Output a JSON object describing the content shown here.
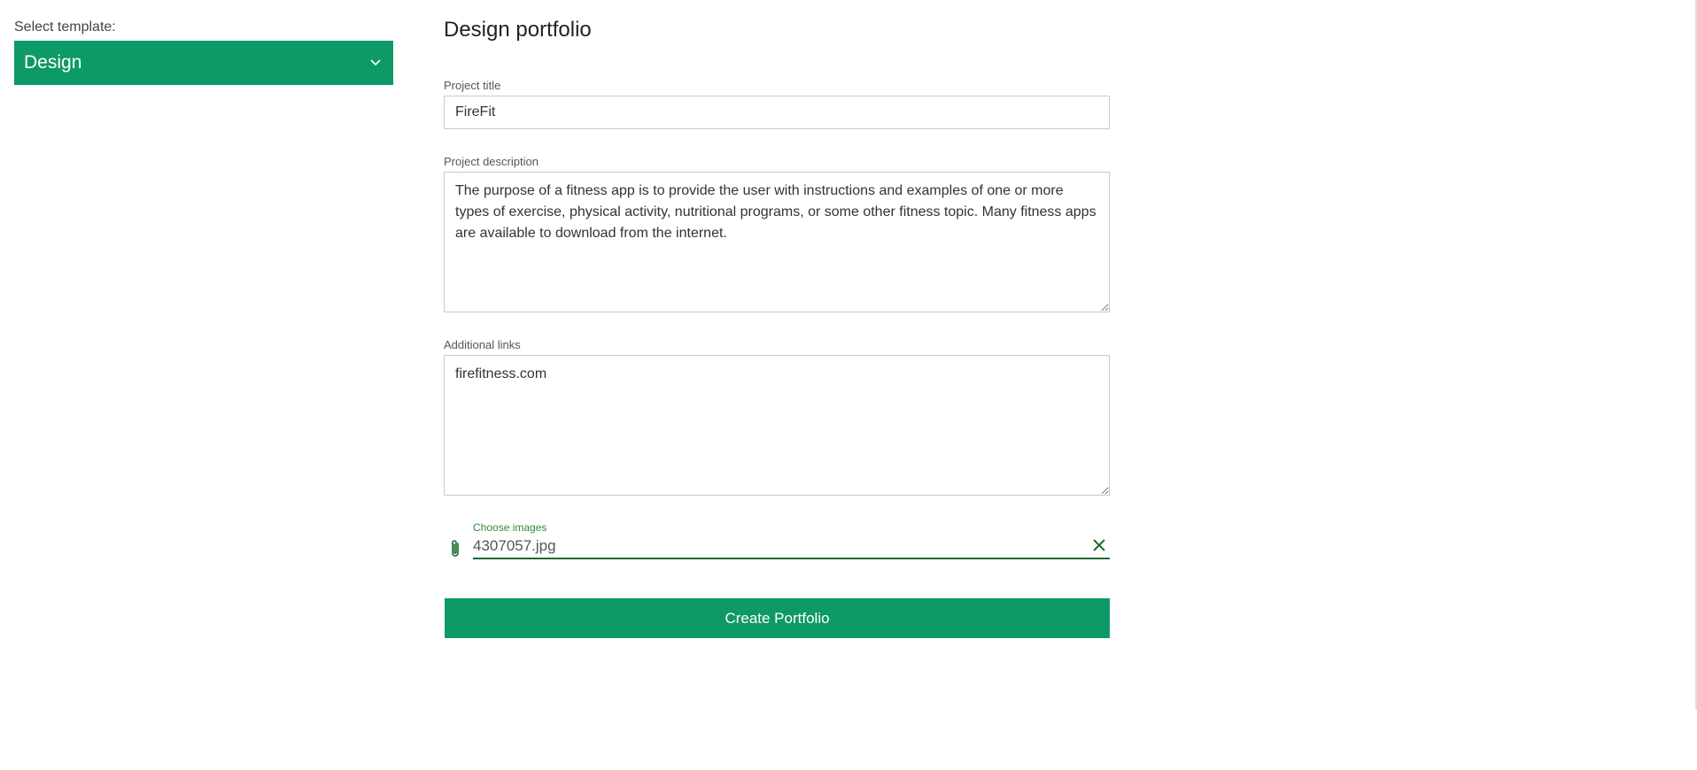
{
  "sidebar": {
    "select_label": "Select template:",
    "template_value": "Design",
    "chevron_icon": "chevron-down-icon"
  },
  "form": {
    "title": "Design portfolio",
    "project_title": {
      "label": "Project title",
      "value": "FireFit"
    },
    "project_description": {
      "label": "Project description",
      "value": "The purpose of a fitness app is to provide the user with instructions and examples of one or more types of exercise, physical activity, nutritional programs, or some other fitness topic. Many fitness apps are available to download from the internet."
    },
    "additional_links": {
      "label": "Additional links",
      "value": "firefitness.com"
    },
    "images": {
      "label": "Choose images",
      "value": "4307057.jpg",
      "attach_icon": "paperclip-icon",
      "clear_icon": "close-icon"
    },
    "submit_label": "Create Portfolio"
  },
  "colors": {
    "accent": "#0e9a66",
    "field_underline": "#1f6b2e",
    "field_label": "#2e8b3c"
  }
}
